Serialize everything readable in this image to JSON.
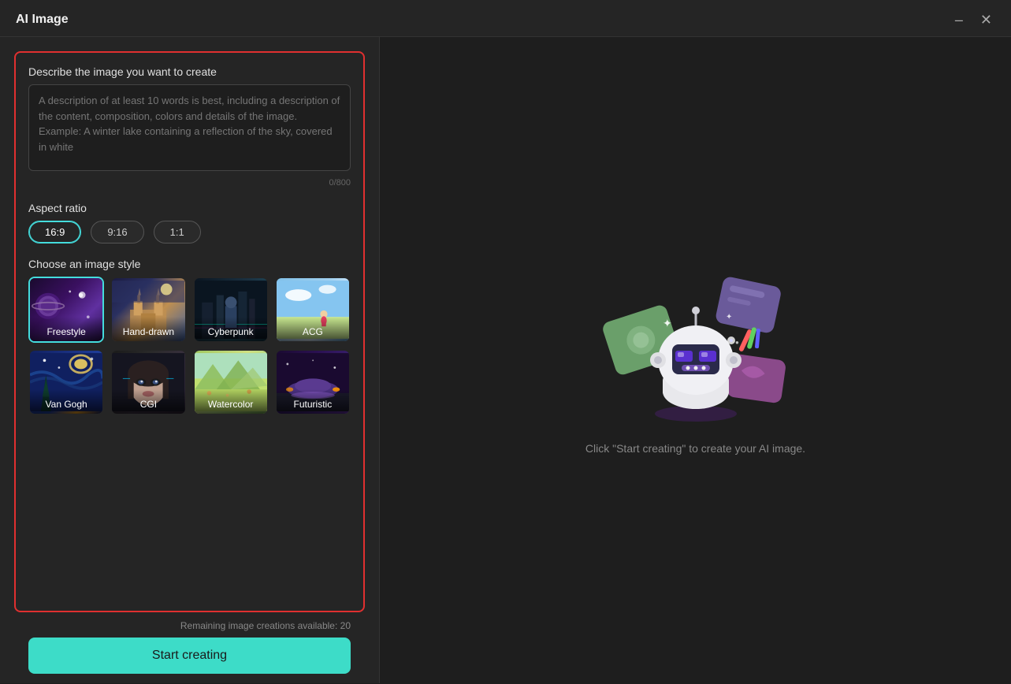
{
  "window": {
    "title": "AI Image"
  },
  "titlebar": {
    "minimize_label": "–",
    "close_label": "✕"
  },
  "left": {
    "describe_label": "Describe the image you want to create",
    "textarea_placeholder": "A description of at least 10 words is best, including a description of the content, composition, colors and details of the image. Example: A winter lake containing a reflection of the sky, covered in white",
    "char_count": "0/800",
    "aspect_ratio_label": "Aspect ratio",
    "aspect_options": [
      {
        "value": "16:9",
        "active": true
      },
      {
        "value": "9:16",
        "active": false
      },
      {
        "value": "1:1",
        "active": false
      }
    ],
    "style_label": "Choose an image style",
    "styles": [
      {
        "id": "freestyle",
        "label": "Freestyle",
        "selected": true
      },
      {
        "id": "hand-drawn",
        "label": "Hand-drawn",
        "selected": false
      },
      {
        "id": "cyberpunk",
        "label": "Cyberpunk",
        "selected": false
      },
      {
        "id": "acg",
        "label": "ACG",
        "selected": false
      },
      {
        "id": "van-gogh",
        "label": "Van Gogh",
        "selected": false
      },
      {
        "id": "cgi",
        "label": "CGI",
        "selected": false
      },
      {
        "id": "watercolor",
        "label": "Watercolor",
        "selected": false
      },
      {
        "id": "futuristic",
        "label": "Futuristic",
        "selected": false
      }
    ]
  },
  "bottom": {
    "remaining_text": "Remaining image creations available: 20",
    "start_label": "Start creating"
  },
  "right": {
    "hint_text": "Click \"Start creating\" to create your AI image."
  }
}
